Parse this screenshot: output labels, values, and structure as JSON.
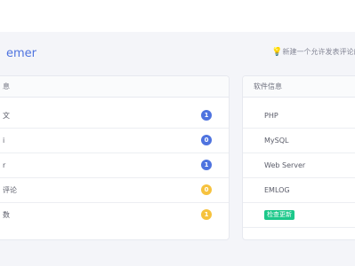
{
  "header": {
    "greeting": "emer",
    "notice": "新建一个允许发表评论的"
  },
  "left_card": {
    "title": "息",
    "rows": [
      {
        "label": "文",
        "count": "1",
        "color": "blue"
      },
      {
        "label": "i",
        "count": "0",
        "color": "blue"
      },
      {
        "label": "r",
        "count": "1",
        "color": "blue"
      },
      {
        "label": "评论",
        "count": "0",
        "color": "yellow"
      },
      {
        "label": "数",
        "count": "1",
        "color": "yellow"
      }
    ]
  },
  "right_card": {
    "title": "软件信息",
    "rows": [
      {
        "label": "PHP"
      },
      {
        "label": "MySQL"
      },
      {
        "label": "Web Server"
      },
      {
        "label": "EMLOG"
      }
    ],
    "check_update_label": "检查更新"
  },
  "colors": {
    "accent": "#4e73df",
    "warning": "#f6c23e",
    "success": "#1cc88a"
  }
}
